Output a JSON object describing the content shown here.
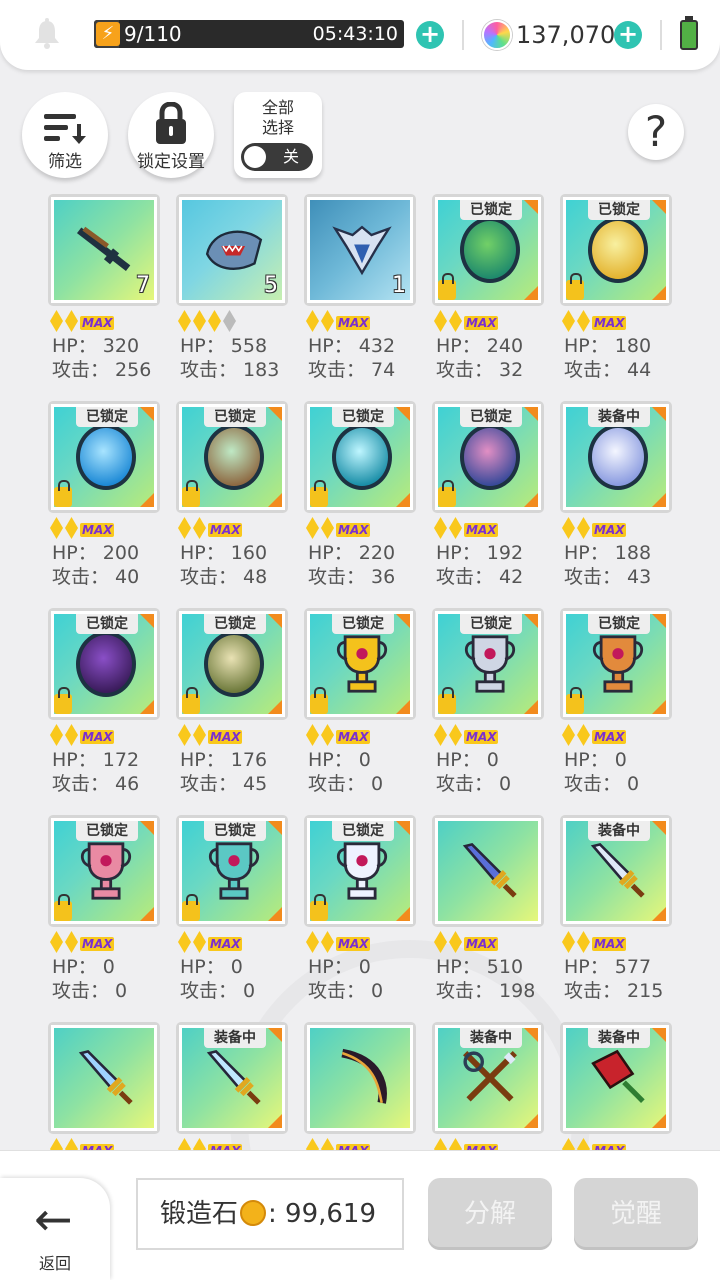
{
  "header": {
    "energy": "9/110",
    "energy_fill_fraction": 0.082,
    "timer": "05:43:10",
    "gems": "137,070",
    "icons": [
      "bell-icon",
      "lightning-icon",
      "plus-icon",
      "gem-icon",
      "battery-icon"
    ]
  },
  "toolbar": {
    "filter_label": "筛选",
    "lock_settings_label": "锁定设置",
    "select_all_label": "全部\n选择",
    "toggle_state": "关",
    "help_label": "?"
  },
  "items": [
    {
      "tag": "",
      "locked": false,
      "count": "7",
      "stars": 2,
      "grey_stars": 0,
      "max": true,
      "hp": "HP： 320",
      "atk": "攻击： 256",
      "art": "lime",
      "glyph": "rifle"
    },
    {
      "tag": "",
      "locked": false,
      "count": "5",
      "stars": 3,
      "grey_stars": 1,
      "max": false,
      "hp": "HP： 558",
      "atk": "攻击： 183",
      "art": "sky",
      "glyph": "shark"
    },
    {
      "tag": "",
      "locked": false,
      "count": "1",
      "stars": 2,
      "grey_stars": 0,
      "max": true,
      "hp": "HP： 432",
      "atk": "攻击： 74",
      "art": "blue",
      "glyph": "crest"
    },
    {
      "tag": "已锁定",
      "locked": true,
      "count": "",
      "stars": 2,
      "grey_stars": 0,
      "max": true,
      "hp": "HP： 240",
      "atk": "攻击： 32",
      "art": "teal",
      "glyph": "orb-green"
    },
    {
      "tag": "已锁定",
      "locked": true,
      "count": "",
      "stars": 2,
      "grey_stars": 0,
      "max": true,
      "hp": "HP： 180",
      "atk": "攻击： 44",
      "art": "teal",
      "glyph": "orb-yellow"
    },
    {
      "tag": "已锁定",
      "locked": true,
      "count": "",
      "stars": 2,
      "grey_stars": 0,
      "max": true,
      "hp": "HP： 200",
      "atk": "攻击： 40",
      "art": "teal",
      "glyph": "orb-blue"
    },
    {
      "tag": "已锁定",
      "locked": true,
      "count": "",
      "stars": 2,
      "grey_stars": 0,
      "max": true,
      "hp": "HP： 160",
      "atk": "攻击： 48",
      "art": "teal",
      "glyph": "orb-brown"
    },
    {
      "tag": "已锁定",
      "locked": true,
      "count": "",
      "stars": 2,
      "grey_stars": 0,
      "max": true,
      "hp": "HP： 220",
      "atk": "攻击： 36",
      "art": "teal",
      "glyph": "orb-cyan"
    },
    {
      "tag": "已锁定",
      "locked": true,
      "count": "",
      "stars": 2,
      "grey_stars": 0,
      "max": true,
      "hp": "HP： 192",
      "atk": "攻击： 42",
      "art": "teal",
      "glyph": "orb-purple"
    },
    {
      "tag": "装备中",
      "locked": false,
      "count": "",
      "stars": 2,
      "grey_stars": 0,
      "max": true,
      "hp": "HP： 188",
      "atk": "攻击： 43",
      "art": "teal",
      "glyph": "orb-white"
    },
    {
      "tag": "已锁定",
      "locked": true,
      "count": "",
      "stars": 2,
      "grey_stars": 0,
      "max": true,
      "hp": "HP： 172",
      "atk": "攻击： 46",
      "art": "teal",
      "glyph": "orb-dark"
    },
    {
      "tag": "已锁定",
      "locked": true,
      "count": "",
      "stars": 2,
      "grey_stars": 0,
      "max": true,
      "hp": "HP： 176",
      "atk": "攻击： 45",
      "art": "teal",
      "glyph": "orb-olive"
    },
    {
      "tag": "已锁定",
      "locked": true,
      "count": "",
      "stars": 2,
      "grey_stars": 0,
      "max": true,
      "hp": "HP： 0",
      "atk": "攻击： 0",
      "art": "teal",
      "glyph": "trophy-gold"
    },
    {
      "tag": "已锁定",
      "locked": true,
      "count": "",
      "stars": 2,
      "grey_stars": 0,
      "max": true,
      "hp": "HP： 0",
      "atk": "攻击： 0",
      "art": "teal",
      "glyph": "trophy-silver"
    },
    {
      "tag": "已锁定",
      "locked": true,
      "count": "",
      "stars": 2,
      "grey_stars": 0,
      "max": true,
      "hp": "HP： 0",
      "atk": "攻击： 0",
      "art": "teal",
      "glyph": "trophy-bronze"
    },
    {
      "tag": "已锁定",
      "locked": true,
      "count": "",
      "stars": 2,
      "grey_stars": 0,
      "max": true,
      "hp": "HP： 0",
      "atk": "攻击： 0",
      "art": "teal",
      "glyph": "trophy-pink"
    },
    {
      "tag": "已锁定",
      "locked": true,
      "count": "",
      "stars": 2,
      "grey_stars": 0,
      "max": true,
      "hp": "HP： 0",
      "atk": "攻击： 0",
      "art": "teal",
      "glyph": "trophy-teal"
    },
    {
      "tag": "已锁定",
      "locked": true,
      "count": "",
      "stars": 2,
      "grey_stars": 0,
      "max": true,
      "hp": "HP： 0",
      "atk": "攻击： 0",
      "art": "teal",
      "glyph": "trophy-white"
    },
    {
      "tag": "",
      "locked": false,
      "count": "",
      "stars": 2,
      "grey_stars": 0,
      "max": true,
      "hp": "HP： 510",
      "atk": "攻击： 198",
      "art": "lime",
      "glyph": "sword-blue"
    },
    {
      "tag": "装备中",
      "locked": false,
      "count": "",
      "stars": 2,
      "grey_stars": 0,
      "max": true,
      "hp": "HP： 577",
      "atk": "攻击： 215",
      "art": "lime",
      "glyph": "sword-gold"
    },
    {
      "tag": "",
      "locked": false,
      "count": "",
      "stars": 2,
      "grey_stars": 0,
      "max": true,
      "hp": "",
      "atk": "",
      "art": "lime",
      "glyph": "sword-rainbow"
    },
    {
      "tag": "装备中",
      "locked": false,
      "count": "",
      "stars": 2,
      "grey_stars": 0,
      "max": true,
      "hp": "",
      "atk": "",
      "art": "lime",
      "glyph": "sword-ice"
    },
    {
      "tag": "",
      "locked": false,
      "count": "",
      "stars": 2,
      "grey_stars": 0,
      "max": true,
      "hp": "",
      "atk": "",
      "art": "lime",
      "glyph": "bow"
    },
    {
      "tag": "装备中",
      "locked": false,
      "count": "",
      "stars": 2,
      "grey_stars": 0,
      "max": true,
      "hp": "",
      "atk": "",
      "art": "lime",
      "glyph": "crossed"
    },
    {
      "tag": "装备中",
      "locked": false,
      "count": "",
      "stars": 2,
      "grey_stars": 0,
      "max": true,
      "hp": "",
      "atk": "",
      "art": "lime",
      "glyph": "cleaver"
    }
  ],
  "max_label": "MAX",
  "footer": {
    "back_label": "返回",
    "forge_label": "锻造石",
    "forge_value": ": 99,619",
    "disassemble_label": "分解",
    "awaken_label": "觉醒"
  }
}
